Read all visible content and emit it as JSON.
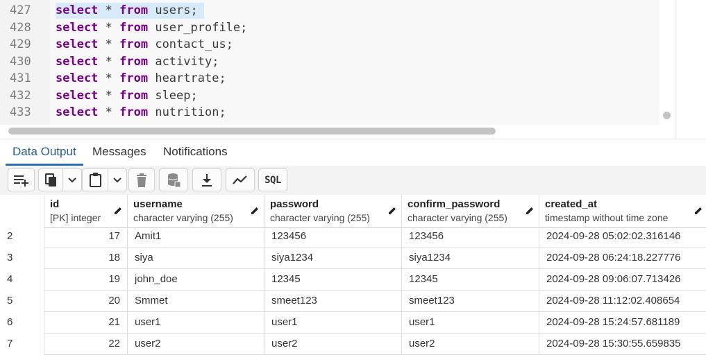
{
  "editor": {
    "lines": [
      {
        "num": "427",
        "kw1": "select",
        "star": " * ",
        "kw2": "from",
        "rest": " users;"
      },
      {
        "num": "428",
        "kw1": "select",
        "star": " * ",
        "kw2": "from",
        "rest": " user_profile;"
      },
      {
        "num": "429",
        "kw1": "select",
        "star": " * ",
        "kw2": "from",
        "rest": " contact_us;"
      },
      {
        "num": "430",
        "kw1": "select",
        "star": " * ",
        "kw2": "from",
        "rest": " activity;"
      },
      {
        "num": "431",
        "kw1": "select",
        "star": " * ",
        "kw2": "from",
        "rest": " heartrate;"
      },
      {
        "num": "432",
        "kw1": "select",
        "star": " * ",
        "kw2": "from",
        "rest": " sleep;"
      },
      {
        "num": "433",
        "kw1": "select",
        "star": " * ",
        "kw2": "from",
        "rest": " nutrition;"
      }
    ],
    "selected_line": "427"
  },
  "tabs": [
    {
      "label": "Data Output",
      "active": true
    },
    {
      "label": "Messages",
      "active": false
    },
    {
      "label": "Notifications",
      "active": false
    }
  ],
  "toolbar": {
    "buttons": [
      "add-row-icon",
      "copy-icon",
      "dropdown-icon",
      "paste-icon",
      "dropdown-icon",
      "delete-icon",
      "save-data-icon",
      "download-icon",
      "graph-icon",
      "sql-icon"
    ],
    "sql_label": "SQL"
  },
  "grid": {
    "columns": [
      {
        "name": "id",
        "type": "[PK] integer"
      },
      {
        "name": "username",
        "type": "character varying (255)"
      },
      {
        "name": "password",
        "type": "character varying (255)"
      },
      {
        "name": "confirm_password",
        "type": "character varying (255)"
      },
      {
        "name": "created_at",
        "type": "timestamp without time zone"
      }
    ],
    "rows": [
      {
        "rownum": "2",
        "id": "17",
        "username": "Amit1",
        "password": "123456",
        "confirm_password": "123456",
        "created_at": "2024-09-28 05:02:02.316146"
      },
      {
        "rownum": "3",
        "id": "18",
        "username": "siya",
        "password": "siya1234",
        "confirm_password": "siya1234",
        "created_at": "2024-09-28 06:24:18.227776"
      },
      {
        "rownum": "4",
        "id": "19",
        "username": "john_doe",
        "password": "12345",
        "confirm_password": "12345",
        "created_at": "2024-09-28 09:06:07.713426"
      },
      {
        "rownum": "5",
        "id": "20",
        "username": "Smmet",
        "password": "smeet123",
        "confirm_password": "smeet123",
        "created_at": "2024-09-28 11:12:02.408654"
      },
      {
        "rownum": "6",
        "id": "21",
        "username": "user1",
        "password": "user1",
        "confirm_password": "user1",
        "created_at": "2024-09-28 15:24:57.681189"
      },
      {
        "rownum": "7",
        "id": "22",
        "username": "user2",
        "password": "user2",
        "confirm_password": "user2",
        "created_at": "2024-09-28 15:30:55.659835"
      }
    ]
  },
  "colors": {
    "keyword": "#770088",
    "selection": "#d7eaf9",
    "active_tab": "#2a6fb0"
  }
}
